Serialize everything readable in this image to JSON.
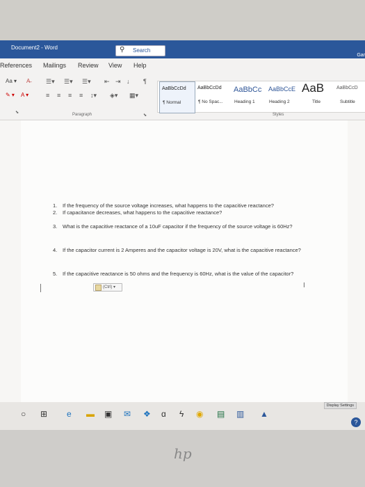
{
  "titlebar": {
    "document": "Document2  -  Word",
    "search": "Search",
    "user": "Gar"
  },
  "tabs": [
    "References",
    "Mailings",
    "Review",
    "View",
    "Help"
  ],
  "ribbon": {
    "font_controls": [
      "Aa ▾",
      "A̶",
      "A ▾"
    ],
    "paragraph_label": "Paragraph",
    "styles_label": "Styles",
    "styles": [
      {
        "sample": "AaBbCcDd",
        "name": "¶ Normal"
      },
      {
        "sample": "AaBbCcDd",
        "name": "¶ No Spac..."
      },
      {
        "sample": "AaBbCc",
        "name": "Heading 1"
      },
      {
        "sample": "AaBbCcE",
        "name": "Heading 2"
      },
      {
        "sample": "AaB",
        "name": "Title"
      },
      {
        "sample": "AaBbCcD",
        "name": "Subtitle"
      }
    ]
  },
  "questions": [
    {
      "num": "1.",
      "text": "If the frequency of the source voltage increases, what happens to the capacitive reactance?"
    },
    {
      "num": "2.",
      "text": "If capacitance decreases, what happens to the capacitive reactance?"
    },
    {
      "num": "3.",
      "text": "What is the capacitive reactance of a 10uF capacitor if the frequency of the source voltage is 60Hz?"
    },
    {
      "num": "4.",
      "text": "If the capacitor current is 2 Amperes and the capacitor voltage is 20V, what is the capacitive reactance?"
    },
    {
      "num": "5.",
      "text": "If the capacitive reactance is 50 ohms and the frequency is 60Hz, what is the value of the capacitor?"
    }
  ],
  "paste_options": "(Ctrl) ▾",
  "taskbar": {
    "display_settings": "Display Settings",
    "help": "?"
  },
  "bezel": {
    "logo": "hp"
  }
}
